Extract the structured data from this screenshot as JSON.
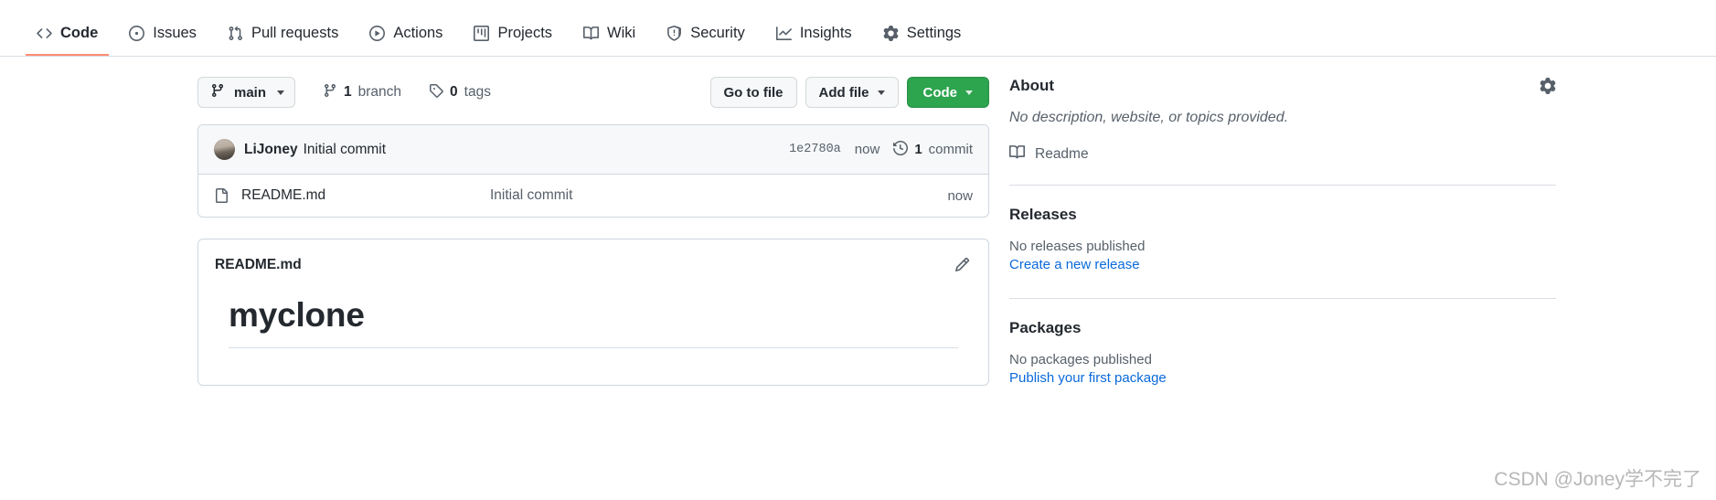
{
  "nav": {
    "items": [
      {
        "label": "Code",
        "icon": "code-icon",
        "selected": true
      },
      {
        "label": "Issues",
        "icon": "issue-icon",
        "selected": false
      },
      {
        "label": "Pull requests",
        "icon": "git-pull-request-icon",
        "selected": false
      },
      {
        "label": "Actions",
        "icon": "play-icon",
        "selected": false
      },
      {
        "label": "Projects",
        "icon": "project-icon",
        "selected": false
      },
      {
        "label": "Wiki",
        "icon": "book-icon",
        "selected": false
      },
      {
        "label": "Security",
        "icon": "shield-icon",
        "selected": false
      },
      {
        "label": "Insights",
        "icon": "graph-icon",
        "selected": false
      },
      {
        "label": "Settings",
        "icon": "gear-icon",
        "selected": false
      }
    ]
  },
  "branch_bar": {
    "current_branch": "main",
    "branch_count_value": "1",
    "branch_count_label": "branch",
    "tag_count_value": "0",
    "tag_count_label": "tags",
    "go_to_file_label": "Go to file",
    "add_file_label": "Add file",
    "code_label": "Code"
  },
  "commit": {
    "author": "LiJoney",
    "message": "Initial commit",
    "sha": "1e2780a",
    "time": "now",
    "count_value": "1",
    "count_label": "commit"
  },
  "files": [
    {
      "name": "README.md",
      "icon": "file-icon",
      "commit_message": "Initial commit",
      "time": "now"
    }
  ],
  "readme": {
    "title": "README.md",
    "heading": "myclone"
  },
  "sidebar": {
    "about": {
      "title": "About",
      "description": "No description, website, or topics provided.",
      "readme_link": "Readme"
    },
    "releases": {
      "title": "Releases",
      "empty": "No releases published",
      "action": "Create a new release"
    },
    "packages": {
      "title": "Packages",
      "empty": "No packages published",
      "action": "Publish your first package"
    }
  },
  "watermark": "CSDN @Joney学不完了",
  "colors": {
    "accent_green": "#2da44e",
    "link_blue": "#0969da",
    "selected_underline": "#fd8c73",
    "muted_text": "#57606a",
    "border": "#d0d7de"
  }
}
